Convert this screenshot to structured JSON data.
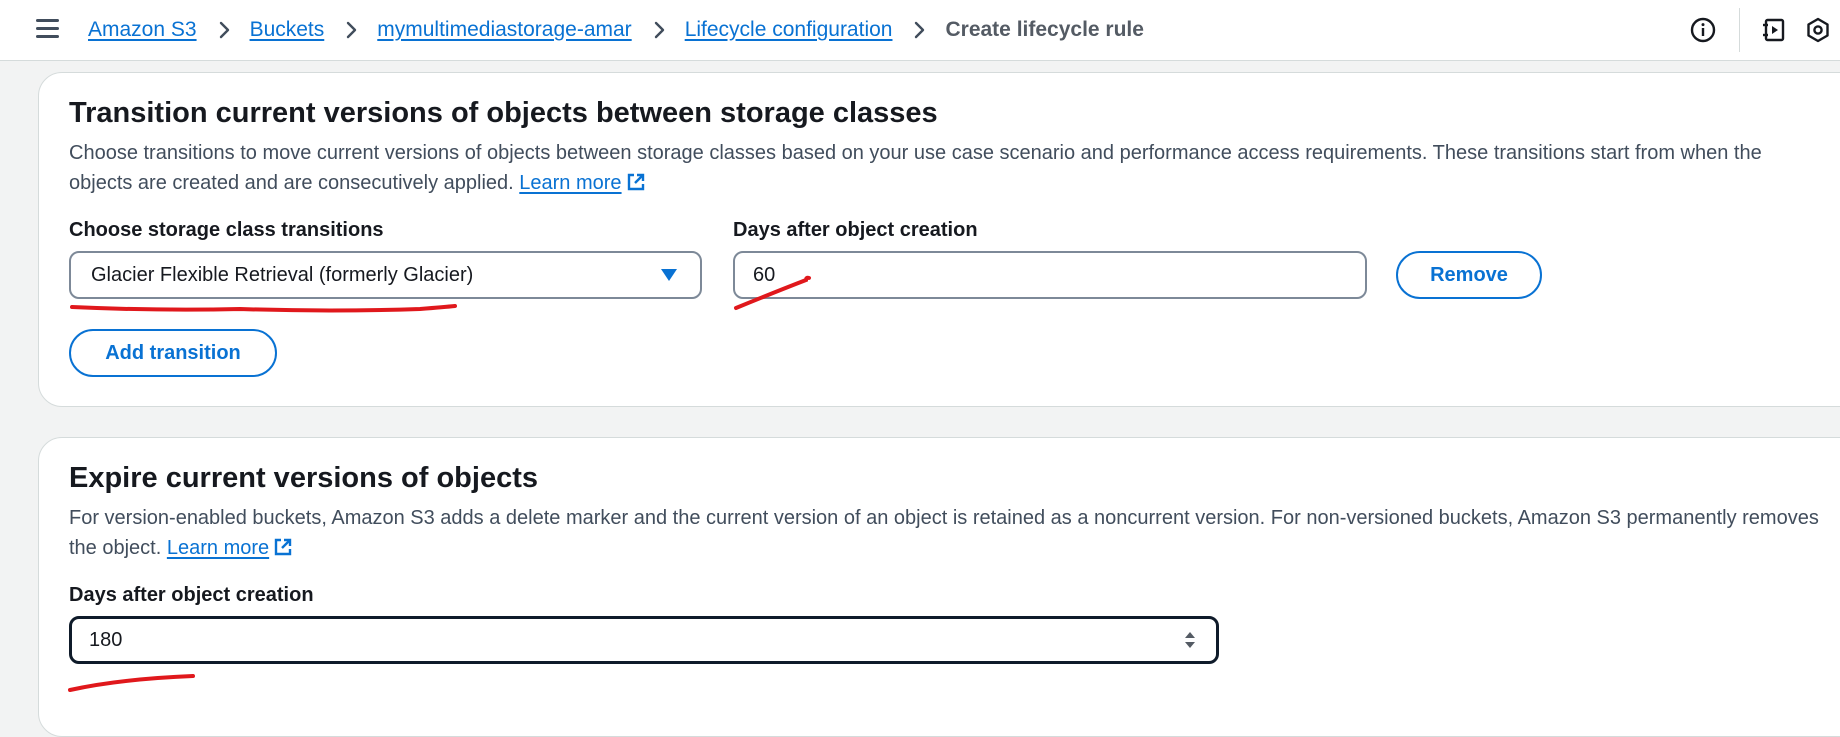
{
  "breadcrumb": {
    "items": [
      "Amazon S3",
      "Buckets",
      "mymultimediastorage-amar",
      "Lifecycle configuration"
    ],
    "current": "Create lifecycle rule"
  },
  "transition_panel": {
    "title": "Transition current versions of objects between storage classes",
    "description": "Choose transitions to move current versions of objects between storage classes based on your use case scenario and performance access requirements. These transitions start from when the objects are created and are consecutively applied.",
    "learn_more": "Learn more",
    "storage_class_label": "Choose storage class transitions",
    "storage_class_value": "Glacier Flexible Retrieval (formerly Glacier)",
    "days_label": "Days after object creation",
    "days_value": "60",
    "remove_label": "Remove",
    "add_transition_label": "Add transition"
  },
  "expire_panel": {
    "title": "Expire current versions of objects",
    "description": "For version-enabled buckets, Amazon S3 adds a delete marker and the current version of an object is retained as a noncurrent version. For non-versioned buckets, Amazon S3 permanently removes the object.",
    "learn_more": "Learn more",
    "days_label": "Days after object creation",
    "days_value": "180"
  },
  "icons": {
    "menu": "hamburger-menu-icon",
    "info": "info-icon",
    "notes": "notes-icon",
    "settings": "settings-icon",
    "external_link": "external-link-icon",
    "caret": "caret-down-icon",
    "spinner": "number-stepper-icon"
  },
  "colors": {
    "link": "#0972d3",
    "annotation": "#e0181c",
    "text": "#16191f",
    "border": "#7d8998"
  }
}
